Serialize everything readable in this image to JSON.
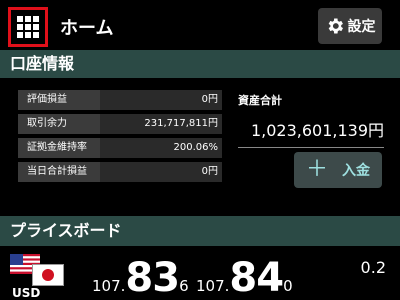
{
  "header": {
    "title": "ホーム",
    "menu_icon": "grid-icon",
    "settings_label": "設定",
    "settings_icon": "gear-icon"
  },
  "account": {
    "title": "口座情報",
    "rows": [
      {
        "label": "評価損益",
        "value": "0円"
      },
      {
        "label": "取引余力",
        "value": "231,717,811円"
      },
      {
        "label": "証拠金維持率",
        "value": "200.06%"
      },
      {
        "label": "当日合計損益",
        "value": "0円"
      }
    ],
    "total_assets_label": "資産合計",
    "total_assets_value": "1,023,601,139円",
    "deposit_label": "入金",
    "deposit_icon": "plus-icon"
  },
  "price_board": {
    "title": "プライスボード",
    "pair": {
      "currency": "USD",
      "bid": {
        "prefix": "107.",
        "big": "83",
        "last": "6"
      },
      "ask": {
        "prefix": "107.",
        "big": "84",
        "last": "0"
      },
      "spread": "0.2"
    }
  },
  "colors": {
    "header_bg": "#2b4a45",
    "highlight_border": "#e0101a",
    "deposit_text": "#9ee0e0"
  }
}
